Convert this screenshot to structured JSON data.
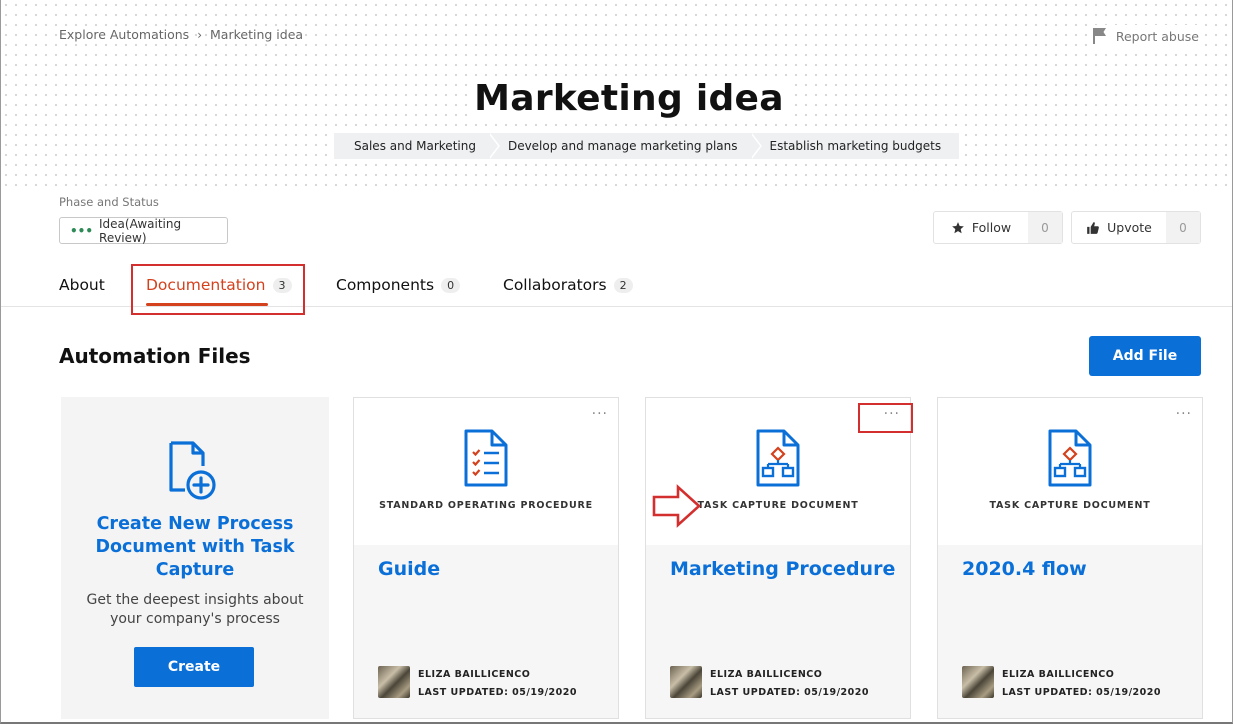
{
  "breadcrumb": {
    "items": [
      "Explore Automations",
      "Marketing idea"
    ],
    "separator": "›"
  },
  "report": {
    "label": "Report abuse",
    "icon": "flag-icon"
  },
  "title": "Marketing idea",
  "tags": [
    "Sales and Marketing",
    "Develop and manage marketing plans",
    "Establish marketing budgets"
  ],
  "phase": {
    "label": "Phase and Status",
    "status": "Idea(Awaiting Review)",
    "status_icon": "dots-icon"
  },
  "follow": {
    "label": "Follow",
    "count": "0",
    "icon": "star-icon"
  },
  "upvote": {
    "label": "Upvote",
    "count": "0",
    "icon": "thumbs-up-icon"
  },
  "tabs": [
    {
      "label": "About",
      "count": null
    },
    {
      "label": "Documentation",
      "count": "3",
      "active": true
    },
    {
      "label": "Components",
      "count": "0"
    },
    {
      "label": "Collaborators",
      "count": "2"
    }
  ],
  "section": {
    "title": "Automation Files",
    "add_button": "Add File"
  },
  "create_card": {
    "title": "Create New Process Document with Task Capture",
    "description": "Get the deepest insights about your company's process",
    "button": "Create",
    "icon": "document-add-icon"
  },
  "documents": [
    {
      "type": "STANDARD OPERATING PROCEDURE",
      "title": "Guide",
      "author": "ELIZA BAILLICENCO",
      "updated": "LAST UPDATED: 05/19/2020",
      "icon": "checklist-document-icon",
      "more": "···"
    },
    {
      "type": "TASK CAPTURE DOCUMENT",
      "title": "Marketing Procedure",
      "author": "ELIZA BAILLICENCO",
      "updated": "LAST UPDATED: 05/19/2020",
      "icon": "flowchart-document-icon",
      "more": "···"
    },
    {
      "type": "TASK CAPTURE DOCUMENT",
      "title": "2020.4 flow",
      "author": "ELIZA BAILLICENCO",
      "updated": "LAST UPDATED: 05/19/2020",
      "icon": "flowchart-document-icon",
      "more": "···"
    }
  ],
  "colors": {
    "accent": "#0b6fd8",
    "active_tab": "#d4411d",
    "annotation": "#d32f2f",
    "status_dots": "#2e8b57"
  }
}
